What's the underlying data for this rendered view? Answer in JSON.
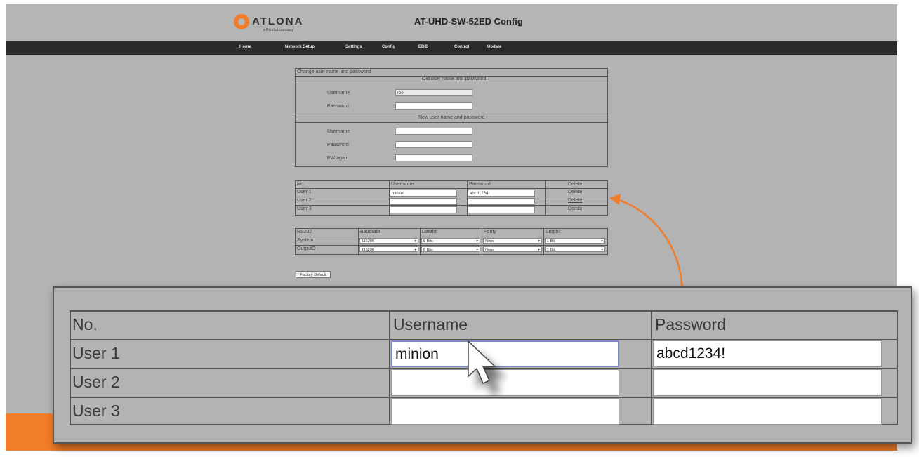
{
  "header": {
    "logo_text": "ATLONA",
    "logo_sub": "a Panduit company",
    "title": "AT-UHD-SW-52ED Config"
  },
  "nav": [
    "Home",
    "Network Setup",
    "Settings",
    "Config",
    "EDID",
    "Control",
    "Update"
  ],
  "account_form": {
    "section_title": "Change user name and password",
    "old_title": "Old user name and password",
    "old_username_label": "Username",
    "old_username_value": "root",
    "old_password_label": "Password",
    "new_title": "New user name and password",
    "new_username_label": "Username",
    "new_password_label": "Password",
    "new_pw_again_label": "PW again"
  },
  "users_table": {
    "headers": [
      "No.",
      "Username",
      "Password",
      "Delete"
    ],
    "rows": [
      {
        "label": "User 1",
        "username": "minion",
        "password": "abcd1234!",
        "delete": "Delete"
      },
      {
        "label": "User 2",
        "username": "",
        "password": "",
        "delete": "Delete"
      },
      {
        "label": "User 3",
        "username": "",
        "password": "",
        "delete": "Delete"
      }
    ]
  },
  "rs232_table": {
    "headers": [
      "RS232",
      "Baudrate",
      "Databit",
      "Parity",
      "Stopbit"
    ],
    "rows": [
      {
        "label": "System",
        "baud": "115200",
        "databit": "8 Bits",
        "parity": "None",
        "stopbit": "1 Bit"
      },
      {
        "label": "OutputD",
        "baud": "115200",
        "databit": "8 Bits",
        "parity": "None",
        "stopbit": "1 Bit"
      }
    ]
  },
  "factory_default_label": "Factory Default",
  "zoom": {
    "headers": [
      "No.",
      "Username",
      "Password"
    ],
    "rows": [
      {
        "label": "User 1",
        "username": "minion",
        "password": "abcd1234!"
      },
      {
        "label": "User 2",
        "username": "",
        "password": ""
      },
      {
        "label": "User 3",
        "username": "",
        "password": ""
      }
    ]
  },
  "colors": {
    "accent": "#f07d2a",
    "navbar": "#2b2b2b",
    "background": "#b3b3b3"
  }
}
